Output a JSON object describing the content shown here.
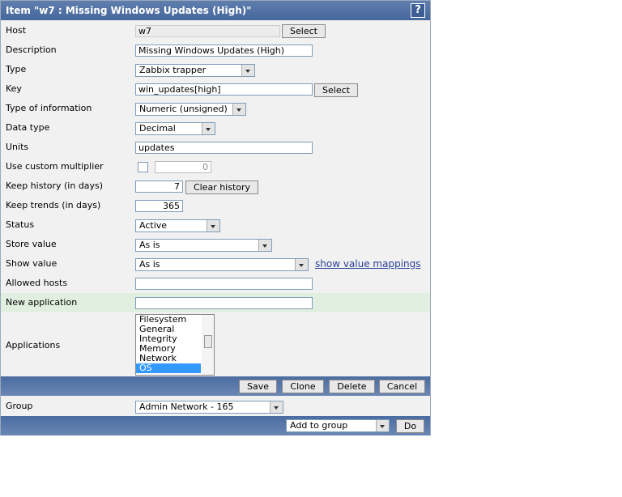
{
  "title": "Item \"w7 : Missing Windows Updates (High)\"",
  "help": "?",
  "host": {
    "label": "Host",
    "value": "w7",
    "button": "Select"
  },
  "description": {
    "label": "Description",
    "value": "Missing Windows Updates (High)"
  },
  "type": {
    "label": "Type",
    "value": "Zabbix trapper"
  },
  "key": {
    "label": "Key",
    "value": "win_updates[high]",
    "button": "Select"
  },
  "type_info": {
    "label": "Type of information",
    "value": "Numeric (unsigned)"
  },
  "data_type": {
    "label": "Data type",
    "value": "Decimal"
  },
  "units": {
    "label": "Units",
    "value": "updates"
  },
  "multiplier": {
    "label": "Use custom multiplier",
    "value": "0"
  },
  "history": {
    "label": "Keep history (in days)",
    "value": "7",
    "button": "Clear history"
  },
  "trends": {
    "label": "Keep trends (in days)",
    "value": "365"
  },
  "status": {
    "label": "Status",
    "value": "Active"
  },
  "store": {
    "label": "Store value",
    "value": "As is"
  },
  "show": {
    "label": "Show value",
    "value": "As is",
    "link": "show value mappings"
  },
  "allowed": {
    "label": "Allowed hosts",
    "value": ""
  },
  "new_app": {
    "label": "New application",
    "value": ""
  },
  "apps": {
    "label": "Applications",
    "options": [
      "Filesystem",
      "General",
      "Integrity",
      "Memory",
      "Network",
      "OS"
    ],
    "selected": "OS"
  },
  "actions": {
    "save": "Save",
    "clone": "Clone",
    "delete": "Delete",
    "cancel": "Cancel"
  },
  "group": {
    "label": "Group",
    "value": "Admin Network - 165"
  },
  "bottom": {
    "action": "Add to group",
    "do": "Do"
  }
}
